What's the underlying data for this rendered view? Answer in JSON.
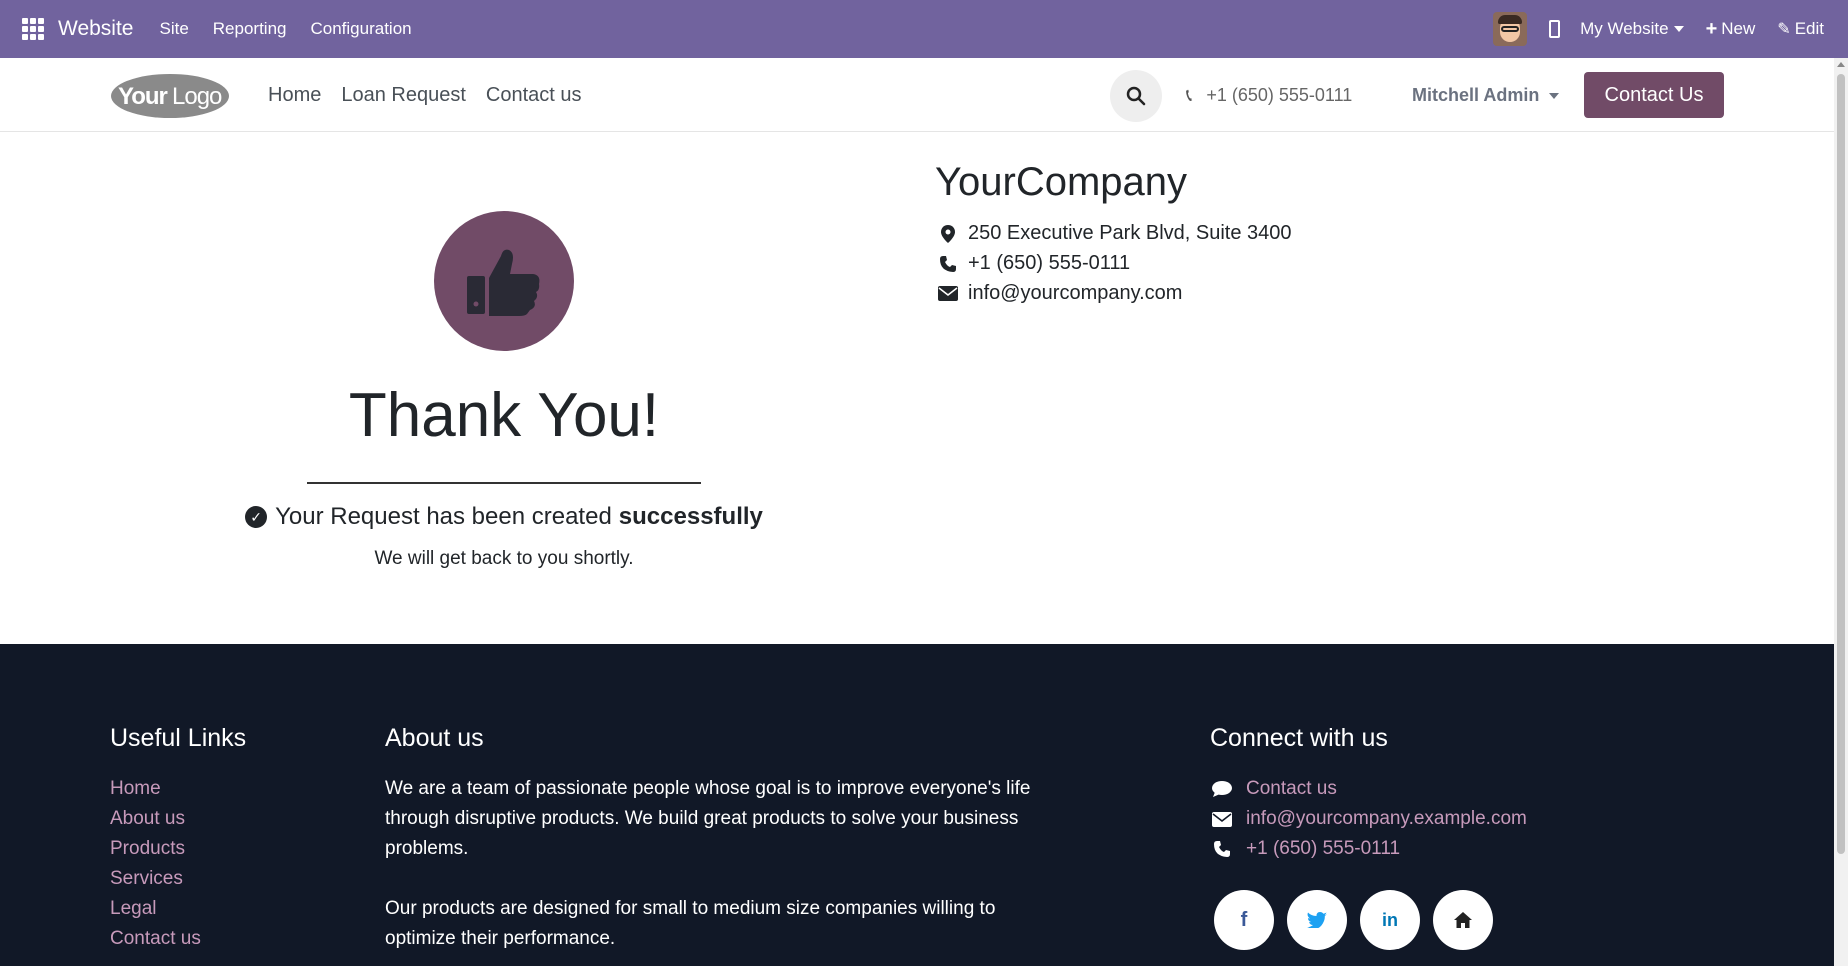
{
  "admin_bar": {
    "app_name": "Website",
    "menus": [
      "Site",
      "Reporting",
      "Configuration"
    ],
    "website_selector": "My Website",
    "new_label": "New",
    "edit_label": "Edit"
  },
  "header": {
    "logo_text": "YourLogo",
    "nav": [
      "Home",
      "Loan Request",
      "Contact us"
    ],
    "phone": "+1 (650) 555-0111",
    "user": "Mitchell Admin",
    "cta": "Contact Us"
  },
  "main": {
    "title": "Thank You!",
    "success_prefix": "Your Request has been created",
    "success_bold": "successfully",
    "subtitle": "We will get back to you shortly."
  },
  "company": {
    "name": "YourCompany",
    "address": "250 Executive Park Blvd, Suite 3400",
    "phone": "+1 (650) 555-0111",
    "email": "info@yourcompany.com"
  },
  "footer": {
    "useful_links_title": "Useful Links",
    "useful_links": [
      "Home",
      "About us",
      "Products",
      "Services",
      "Legal",
      "Contact us"
    ],
    "about_title": "About us",
    "about_p1": "We are a team of passionate people whose goal is to improve everyone's life through disruptive products. We build great products to solve your business problems.",
    "about_p2": "Our products are designed for small to medium size companies willing to optimize their performance.",
    "connect_title": "Connect with us",
    "connect_contact": "Contact us",
    "connect_email": "info@yourcompany.example.com",
    "connect_phone": "+1 (650) 555-0111",
    "social": [
      "facebook",
      "twitter",
      "linkedin",
      "home"
    ]
  },
  "colors": {
    "admin_bar": "#71639e",
    "brand": "#714b67",
    "footer_bg": "#111827",
    "footer_link": "#c79abb"
  }
}
